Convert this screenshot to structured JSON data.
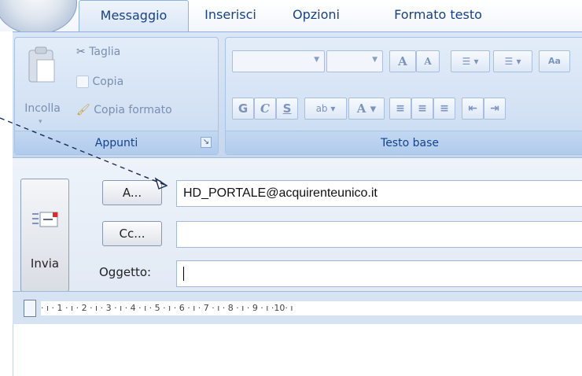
{
  "tabs": [
    "Messaggio",
    "Inserisci",
    "Opzioni",
    "Formato testo"
  ],
  "active_tab": "Messaggio",
  "ribbon": {
    "clipboard": {
      "paste_label": "Incolla",
      "cut_label": "Taglia",
      "copy_label": "Copia",
      "format_painter_label": "Copia formato",
      "group_label": "Appunti"
    },
    "basic_text": {
      "group_label": "Testo base",
      "bold": "G",
      "italic": "C",
      "underline": "S",
      "grow_font": "A",
      "shrink_font": "A",
      "highlight": "ab",
      "font_color": "A"
    }
  },
  "header": {
    "send_label": "Invia",
    "to_button": "A...",
    "cc_button": "Cc...",
    "subject_label": "Oggetto:",
    "to_value": "HD_PORTALE@acquirenteunico.it",
    "cc_value": "",
    "subject_value": ""
  },
  "ruler": {
    "scale": "· ı · 1 · ı · 2 · ı · 3 · ı · 4 · ı · 5 · ı · 6 · ı · 7 · ı · 8 · ı · 9 · ı ·10· ı"
  }
}
